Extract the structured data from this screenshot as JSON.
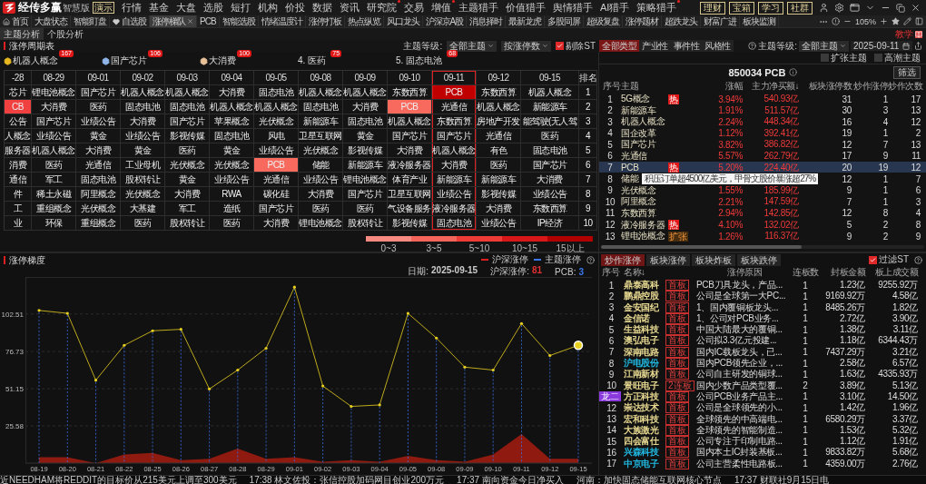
{
  "app": {
    "logo": "经传多赢",
    "edition": "智慧版",
    "badge": "演示"
  },
  "menu": [
    {
      "label": "行情",
      "dot": false
    },
    {
      "label": "基金",
      "dot": false
    },
    {
      "label": "大盘",
      "dot": false
    },
    {
      "label": "选股",
      "dot": false
    },
    {
      "label": "短打",
      "dot": false
    },
    {
      "label": "机构",
      "dot": false
    },
    {
      "label": "价投",
      "dot": false
    },
    {
      "label": "数据",
      "dot": false
    },
    {
      "label": "资讯",
      "dot": false
    },
    {
      "label": "研究院",
      "dot": true
    },
    {
      "label": "交易",
      "dot": false
    },
    {
      "label": "增值",
      "dot": true
    },
    {
      "label": "主题猎手",
      "dot": false
    },
    {
      "label": "价值猎手",
      "dot": false
    },
    {
      "label": "舆情猎手",
      "dot": false
    },
    {
      "label": "AI猎手",
      "dot": false
    },
    {
      "label": "策略猎手",
      "dot": true
    }
  ],
  "top_buttons": [
    "理财",
    "宝箱",
    "学习",
    "社群"
  ],
  "tabs": [
    {
      "label": "首页",
      "kind": "home",
      "selected": false
    },
    {
      "label": "大盘状态",
      "selected": false
    },
    {
      "label": "智能盯盘",
      "selected": false
    },
    {
      "label": "自选股",
      "kind": "heart",
      "selected": false
    },
    {
      "label": "涨停梯队",
      "selected": true
    },
    {
      "label": "PCB",
      "selected": false
    },
    {
      "label": "智能选股",
      "selected": false
    },
    {
      "label": "情绪温度计",
      "selected": false
    },
    {
      "label": "涨停打板",
      "selected": false
    },
    {
      "label": "热点纵览",
      "selected": false
    },
    {
      "label": "风口龙头",
      "selected": false
    },
    {
      "label": "沪深京A股",
      "selected": false
    },
    {
      "label": "消息择时",
      "selected": false
    },
    {
      "label": "最新龙虎",
      "selected": false
    },
    {
      "label": "多股同屏",
      "selected": false
    },
    {
      "label": "超级复盘",
      "selected": false
    },
    {
      "label": "涨停题材",
      "selected": false
    },
    {
      "label": "超跌龙头",
      "selected": false
    },
    {
      "label": "财富广进",
      "selected": false
    },
    {
      "label": "板块监测",
      "selected": false
    }
  ],
  "zoom": "105%",
  "subtabs": [
    {
      "label": "主题分析",
      "selected": true
    },
    {
      "label": "个股分析",
      "selected": false
    }
  ],
  "teach": "教学",
  "cycle_panel": {
    "title": "涨停周期表",
    "level_label": "主题等级:",
    "level_select": "全部主题",
    "sort_select": "按涨停数",
    "exclude_st": {
      "label": "剔除ST",
      "checked": true
    },
    "leaders": [
      {
        "label": "机器人概念",
        "count": "167",
        "color": "#e8b820"
      },
      {
        "label": "国产芯片",
        "count": "106",
        "color": "#8fb4e8"
      },
      {
        "label": "大消费",
        "count": "100",
        "color": "#e8c098"
      },
      {
        "label": "4. 医药",
        "count": "75"
      },
      {
        "label": "5. 固态电池",
        "count": "68"
      }
    ],
    "columns": [
      {
        "label": "-28",
        "selected": false
      },
      {
        "label": "08-29",
        "selected": false
      },
      {
        "label": "09-01",
        "selected": false
      },
      {
        "label": "09-02",
        "selected": false
      },
      {
        "label": "09-03",
        "selected": false
      },
      {
        "label": "09-04",
        "selected": false
      },
      {
        "label": "09-05",
        "selected": false
      },
      {
        "label": "09-08",
        "selected": false
      },
      {
        "label": "09-09",
        "selected": false
      },
      {
        "label": "09-10",
        "selected": false
      },
      {
        "label": "09-11",
        "selected": true
      },
      {
        "label": "09-12",
        "selected": false
      },
      {
        "label": "09-15",
        "selected": false
      }
    ],
    "rank_header": "排名",
    "rows": [
      {
        "rank": "1",
        "cells": [
          "芯片",
          "锂电池概念",
          "国产芯片",
          "机器人概念",
          "机器人概念",
          "大消费",
          "固态电池",
          "机器人概念",
          "机器人概念",
          "东数西算",
          {
            "text": "PCB",
            "color": "#c00000"
          },
          "东数西算",
          "机器人概念"
        ]
      },
      {
        "rank": "2",
        "cells": [
          {
            "text": "CB",
            "color": "#f04040"
          },
          "大消费",
          "医药",
          "固态电池",
          "固态电池",
          "机器人概念",
          "机器人概念",
          "固态电池",
          "大消费",
          {
            "text": "PCB",
            "color": "#f86a5e"
          },
          "光通信",
          "机器人概念",
          "新能源车"
        ]
      },
      {
        "rank": "3",
        "cells": [
          "公告",
          "国产芯片",
          "业绩公告",
          "大消费",
          "国产芯片",
          "苹果概念",
          "光伏概念",
          "新能源车",
          "固态电池",
          "机器人概念",
          "东数西算",
          "房地产开发",
          "能驾驶(无人驾"
        ]
      },
      {
        "rank": "4",
        "cells": [
          "人概念",
          "业绩公告",
          "黄金",
          "业绩公告",
          "影视传媒",
          "固态电池",
          "风电",
          "卫星互联网",
          "黄金",
          "国产芯片",
          "国产芯片",
          "光通信",
          "医药"
        ]
      },
      {
        "rank": "5",
        "cells": [
          "服务器",
          "机器人概念",
          "大消费",
          "黄金",
          "医药",
          "黄金",
          "业绩公告",
          "光伏概念",
          "影视传媒",
          "大消费",
          "机器人概念",
          "有色",
          "固态电池"
        ]
      },
      {
        "rank": "6",
        "cells": [
          "消费",
          "医药",
          "光通信",
          "工业母机",
          "光伏概念",
          "光伏概念",
          {
            "text": "PCB",
            "color": "#f86a5e"
          },
          "储能",
          "新能源车",
          "液冷服务器",
          "大消费",
          "医药",
          "国产芯片"
        ]
      },
      {
        "rank": "7",
        "cells": [
          "通信",
          "军工",
          "固态电池",
          "股权转让",
          "黄金",
          "业绩公告",
          "光通信",
          "业绩公告",
          "锂电池概念",
          "体育产业",
          "新能源车",
          "新能源车",
          "大消费"
        ]
      },
      {
        "rank": "8",
        "cells": [
          "件",
          "稀土永磁",
          "阿里概念",
          "光伏概念",
          "大消费",
          "RWA",
          "碳化硅",
          "大消费",
          "国产芯片",
          "卫星互联网",
          "业绩公告",
          "影视传媒",
          "业绩公告"
        ]
      },
      {
        "rank": "9",
        "cells": [
          "工",
          "重组概念",
          "光伏概念",
          "大基建",
          "军工",
          "造纸",
          "国产芯片",
          "医药",
          "医药",
          "气设备服务",
          "液冷服务器",
          "大消费",
          "东数西算"
        ]
      },
      {
        "rank": "10",
        "cells": [
          "业",
          "环保",
          "重组概念",
          "医药",
          "股权转让",
          "医药",
          "大消费",
          "锂电池概念",
          "股权转让",
          "影视传媒",
          "固态电池",
          "业绩公告",
          "IP经济"
        ]
      }
    ],
    "heat_legend": [
      {
        "label": "0~3",
        "color": "#f78a80"
      },
      {
        "label": "3~5",
        "color": "#f5645a"
      },
      {
        "label": "5~10",
        "color": "#ee3b35"
      },
      {
        "label": "10~15",
        "color": "#d81818"
      },
      {
        "label": "15以上",
        "color": "#b00000"
      }
    ]
  },
  "type_tabs": [
    {
      "label": "全部类型",
      "selected": true
    },
    {
      "label": "产业性",
      "selected": false
    },
    {
      "label": "事件性",
      "selected": false
    },
    {
      "label": "风格性",
      "selected": false
    }
  ],
  "right_filter": {
    "level_label": "主题等级:",
    "level_select": "全部主题",
    "date": "2025-09-11"
  },
  "theme_panel": {
    "expand": {
      "label": "扩张主题",
      "checked": false
    },
    "climax": {
      "label": "高潮主题",
      "checked": false
    },
    "title": "850034 PCB",
    "filter_button": "筛选",
    "columns": [
      "序号",
      "主题",
      "涨幅",
      "主力净买额↓",
      "板块涨停数",
      "炒作涨停",
      "炒作次数"
    ],
    "rows": [
      {
        "no": "1",
        "name": "5G概念",
        "tag": {
          "label": "热",
          "kind": "hot"
        },
        "change": "3.94%",
        "net_buy": "540.93亿",
        "limit_ups": "31",
        "hype_limit_ups": "1",
        "hype_times": "17",
        "selected": false
      },
      {
        "no": "2",
        "name": "新能源车",
        "change": "1.91%",
        "net_buy": "511.57亿",
        "limit_ups": "30",
        "hype_limit_ups": "3",
        "hype_times": "13",
        "selected": false
      },
      {
        "no": "3",
        "name": "机器人概念",
        "change": "2.24%",
        "net_buy": "448.34亿",
        "limit_ups": "16",
        "hype_limit_ups": "4",
        "hype_times": "12",
        "selected": false
      },
      {
        "no": "4",
        "name": "国企改革",
        "change": "1.12%",
        "net_buy": "392.41亿",
        "limit_ups": "19",
        "hype_limit_ups": "1",
        "hype_times": "2",
        "selected": false
      },
      {
        "no": "5",
        "name": "国产芯片",
        "change": "3.82%",
        "net_buy": "386.82亿",
        "limit_ups": "12",
        "hype_limit_ups": "7",
        "hype_times": "13",
        "selected": false
      },
      {
        "no": "6",
        "name": "光通信",
        "change": "5.57%",
        "net_buy": "262.79亿",
        "limit_ups": "17",
        "hype_limit_ups": "9",
        "hype_times": "11",
        "selected": false
      },
      {
        "no": "7",
        "name": "PCB",
        "tag": {
          "label": "热",
          "kind": "hot"
        },
        "change": "5.20%",
        "net_buy": "224.40亿",
        "limit_ups": "20",
        "hype_limit_ups": "19",
        "hype_times": "12",
        "selected": true
      },
      {
        "no": "8",
        "name": "储能",
        "limit_ups": "12",
        "hype_limit_ups": "1",
        "hype_times": "7",
        "selected": false,
        "tooltip": "积压订单超4500亿美元，甲骨文股价暴涨超27%"
      },
      {
        "no": "9",
        "name": "光伏概念",
        "change": "1.55%",
        "net_buy": "185.99亿",
        "limit_ups": "9",
        "hype_limit_ups": "1",
        "hype_times": "6",
        "selected": false
      },
      {
        "no": "10",
        "name": "阿里概念",
        "change": "2.21%",
        "net_buy": "147.59亿",
        "limit_ups": "7",
        "hype_limit_ups": "1",
        "hype_times": "3",
        "selected": false
      },
      {
        "no": "11",
        "name": "东数西算",
        "change": "2.94%",
        "net_buy": "142.85亿",
        "limit_ups": "12",
        "hype_limit_ups": "8",
        "hype_times": "4",
        "selected": false
      },
      {
        "no": "12",
        "name": "液冷服务器",
        "tag": {
          "label": "热",
          "kind": "hot"
        },
        "change": "4.10%",
        "net_buy": "132.02亿",
        "limit_ups": "5",
        "hype_limit_ups": "2",
        "hype_times": "8",
        "selected": false
      },
      {
        "no": "13",
        "name": "锂电池概念",
        "tag": {
          "label": "扩张",
          "kind": "expand"
        },
        "change": "1.26%",
        "net_buy": "116.37亿",
        "limit_ups": "9",
        "hype_limit_ups": "2",
        "hype_times": "9",
        "selected": false
      }
    ]
  },
  "trend_panel": {
    "title": "涨停梯度",
    "legend": [
      {
        "color": "#e02020"
      },
      {
        "color": "#3a78f0"
      }
    ],
    "info": [
      {
        "label": "日期:",
        "value": "2025-09-15",
        "color": "#cccccc"
      },
      {
        "label": "沪深涨停:",
        "value": "81",
        "color": "#e03030"
      },
      {
        "label": "PCB:",
        "value": "3",
        "color": "#3a78f0"
      }
    ],
    "chart_data": {
      "type": "line",
      "x": [
        "08-19",
        "08-20",
        "08-21",
        "08-22",
        "08-25",
        "08-26",
        "08-27",
        "08-28",
        "08-29",
        "09-01",
        "09-02",
        "09-03",
        "09-04",
        "09-05",
        "09-08",
        "09-09",
        "09-10",
        "09-11",
        "09-12",
        "09-15"
      ],
      "series": [
        {
          "name": "沪深涨停",
          "type": "line",
          "color": "#e8d020",
          "values": [
            105,
            103,
            57,
            81,
            91,
            92,
            51,
            64,
            79,
            121,
            53,
            39,
            40,
            103,
            86,
            66,
            64,
            96,
            74,
            81
          ]
        },
        {
          "name": "主题涨停",
          "type": "area",
          "color": "#8e1a10",
          "values": [
            4,
            4,
            0,
            6,
            7,
            2,
            3,
            10,
            3,
            4,
            1,
            2,
            1,
            5,
            2,
            1,
            6,
            20,
            3,
            3
          ]
        }
      ],
      "grid": true,
      "ylim": [
        0,
        128
      ],
      "yticks": [
        25.58,
        51.15,
        76.73,
        102.51
      ]
    }
  },
  "stock_panel": {
    "tabs": [
      {
        "label": "炒作涨停",
        "selected": true
      },
      {
        "label": "板块涨停",
        "selected": false
      },
      {
        "label": "板块炸板",
        "selected": false
      },
      {
        "label": "板块跌停",
        "selected": false
      }
    ],
    "filter_st": {
      "label": "过滤ST",
      "checked": true
    },
    "columns": [
      "序号",
      "名称↓",
      "涨停原因",
      "连板数",
      "封板金额",
      "板上成交额"
    ],
    "rows": [
      {
        "no": "1",
        "kind": "plain",
        "name": "鼎泰高科",
        "color": "#e6d890",
        "tag": "首板",
        "reason": "PCB刀具龙头，产品...",
        "boards": "1",
        "seal": "1.23亿",
        "turnover": "9255.92万"
      },
      {
        "no": "2",
        "kind": "plain",
        "name": "鹏鼎控股",
        "color": "#e6d890",
        "tag": "首板",
        "reason": "公司是全球第一大PC...",
        "boards": "1",
        "seal": "9169.92万",
        "turnover": "4.58亿"
      },
      {
        "no": "3",
        "kind": "plain",
        "name": "金安国纪",
        "color": "#e6d890",
        "tag": "首板",
        "reason": "1、国内覆铜板龙头...",
        "boards": "1",
        "seal": "8485.26万",
        "turnover": "1.82亿"
      },
      {
        "no": "4",
        "kind": "plain",
        "name": "金信诺",
        "color": "#e6d890",
        "tag": "首板",
        "reason": "1、公司对PCB业务...",
        "boards": "1",
        "seal": "2.72亿",
        "turnover": "3.90亿"
      },
      {
        "no": "5",
        "kind": "plain",
        "name": "生益科技",
        "color": "#e6d890",
        "tag": "首板",
        "reason": "中国大陆最大的覆铜...",
        "boards": "1",
        "seal": "1.38亿",
        "turnover": "3.11亿"
      },
      {
        "no": "6",
        "kind": "plain",
        "name": "澳弘电子",
        "color": "#e6d890",
        "tag": "首板",
        "reason": "公司拟3.3亿元投建...",
        "boards": "1",
        "seal": "1.18亿",
        "turnover": "6344.43万"
      },
      {
        "no": "7",
        "kind": "plain",
        "name": "深南电路",
        "color": "#e6d890",
        "tag": "首板",
        "reason": "国内IC载板龙头，已...",
        "boards": "1",
        "seal": "7437.29万",
        "turnover": "3.21亿"
      },
      {
        "no": "8",
        "kind": "plain",
        "name": "沪电股份",
        "color": "#20b8e0",
        "tag": "首板",
        "reason": "国内PCB领先企业，...",
        "boards": "1",
        "seal": "2.58亿",
        "turnover": "6.57亿"
      },
      {
        "no": "9",
        "kind": "plain",
        "name": "江南新材",
        "color": "#e6d890",
        "tag": "首板",
        "reason": "公司自主研发的铜球...",
        "boards": "1",
        "seal": "1.63亿",
        "turnover": "4335.93万"
      },
      {
        "no": "10",
        "kind": "plain",
        "name": "景旺电子",
        "color": "#e6d890",
        "tag": "2连板",
        "reason": "国内少数产品类型覆...",
        "boards": "2",
        "seal": "3.89亿",
        "turnover": "5.13亿"
      },
      {
        "no": "龙二",
        "kind": "badge",
        "name": "方正科技",
        "color": "#e6d890",
        "tag": "首板",
        "reason": "公司PCB业务产品主...",
        "boards": "1",
        "seal": "3.10亿",
        "turnover": "14.50亿"
      },
      {
        "no": "12",
        "kind": "plain",
        "name": "崇达技术",
        "color": "#e6d890",
        "tag": "首板",
        "reason": "公司是全球领先的小...",
        "boards": "1",
        "seal": "1.42亿",
        "turnover": "1.96亿"
      },
      {
        "no": "13",
        "kind": "plain",
        "name": "宏和科技",
        "color": "#e6d890",
        "tag": "首板",
        "reason": "全球领先的中高端电...",
        "boards": "1",
        "seal": "6580.29万",
        "turnover": "3.37亿"
      },
      {
        "no": "14",
        "kind": "plain",
        "name": "大族激光",
        "color": "#e6d890",
        "tag": "首板",
        "reason": "全球领先的智能制造...",
        "boards": "1",
        "seal": "1.53亿",
        "turnover": "5.32亿"
      },
      {
        "no": "15",
        "kind": "plain",
        "name": "四会富仕",
        "color": "#e6d890",
        "tag": "首板",
        "reason": "公司专注于印制电路...",
        "boards": "1",
        "seal": "1.12亿",
        "turnover": "1.91亿"
      },
      {
        "no": "16",
        "kind": "plain",
        "name": "兴森科技",
        "color": "#20b8e0",
        "tag": "首板",
        "reason": "国内本土IC封装基板...",
        "boards": "1",
        "seal": "9833.82万",
        "turnover": "5.68亿"
      },
      {
        "no": "17",
        "kind": "plain",
        "name": "中京电子",
        "color": "#20b8e0",
        "tag": "首板",
        "reason": "公司主营柔性电路板...",
        "boards": "1",
        "seal": "4359.00万",
        "turnover": "2.76亿"
      }
    ]
  },
  "ticker": [
    "近NEEDHAM将REDDIT的目标价从215美元上调至300美元",
    "17:38 林文佐投：张信控股加码网目创业200万元",
    "17:37 南向资金今日净买入",
    "河南：加快固态储能互联网核心节点",
    "17:37 财联社9月15日电"
  ]
}
